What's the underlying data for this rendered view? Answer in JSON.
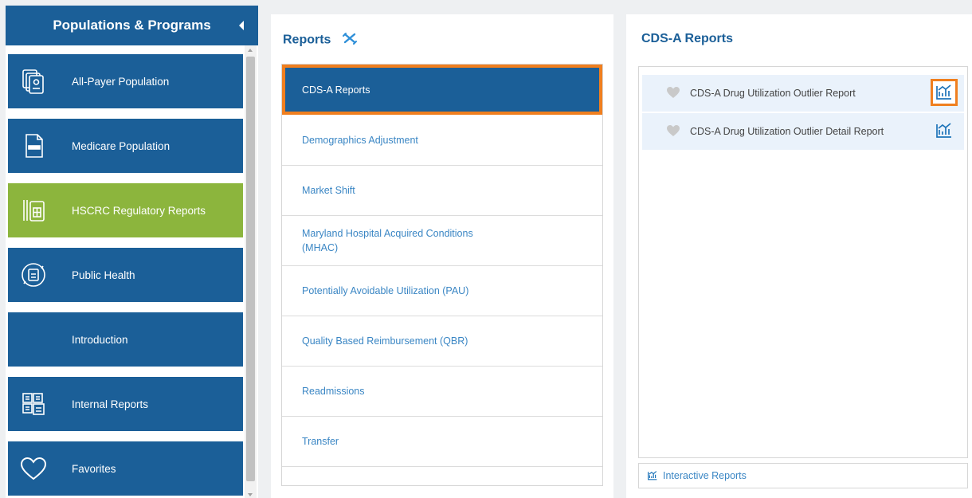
{
  "sidebar": {
    "title": "Populations & Programs",
    "items": [
      {
        "label": "All-Payer Population",
        "icon": "document-stack-icon"
      },
      {
        "label": "Medicare Population",
        "icon": "medicare-card-icon"
      },
      {
        "label": "HSCRC Regulatory Reports",
        "icon": "regulatory-document-icon"
      },
      {
        "label": "Public Health",
        "icon": "public-health-icon"
      },
      {
        "label": "Introduction",
        "icon": ""
      },
      {
        "label": "Internal Reports",
        "icon": "internal-reports-icon"
      },
      {
        "label": "Favorites",
        "icon": "heart-icon"
      }
    ],
    "active_index": 2
  },
  "reports": {
    "title": "Reports",
    "items": [
      "CDS-A Reports",
      "Demographics Adjustment",
      "Market Shift",
      "Maryland Hospital Acquired Conditions (MHAC)",
      "Potentially Avoidable Utilization (PAU)",
      "Quality Based Reimbursement (QBR)",
      "Readmissions",
      "Transfer"
    ],
    "selected_index": 0
  },
  "cds": {
    "title": "CDS-A Reports",
    "rows": [
      {
        "label": "CDS-A Drug Utilization Outlier Report",
        "icon": "bar-chart-icon"
      },
      {
        "label": "CDS-A Drug Utilization Outlier Detail Report",
        "icon": "bar-chart-icon"
      }
    ],
    "interactive_label": "Interactive Reports"
  },
  "colors": {
    "primary": "#1b5f98",
    "active": "#8cb53d",
    "highlight": "#f07f1f",
    "link": "#3a86c4"
  }
}
